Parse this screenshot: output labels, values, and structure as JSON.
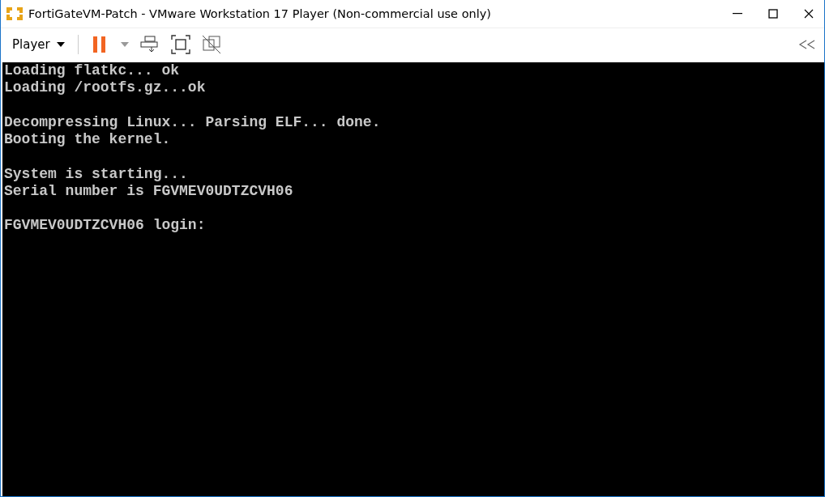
{
  "window": {
    "title": "FortiGateVM-Patch - VMware Workstation 17 Player (Non-commercial use only)"
  },
  "toolbar": {
    "menu": "Player"
  },
  "console": {
    "blocks": [
      [
        "Loading flatkc... ok",
        "Loading /rootfs.gz...ok"
      ],
      [
        "Decompressing Linux... Parsing ELF... done.",
        "Booting the kernel."
      ],
      [
        "System is starting...",
        "Serial number is FGVMEV0UDTZCVH06"
      ],
      [
        "FGVMEV0UDTZCVH06 login:"
      ]
    ]
  }
}
